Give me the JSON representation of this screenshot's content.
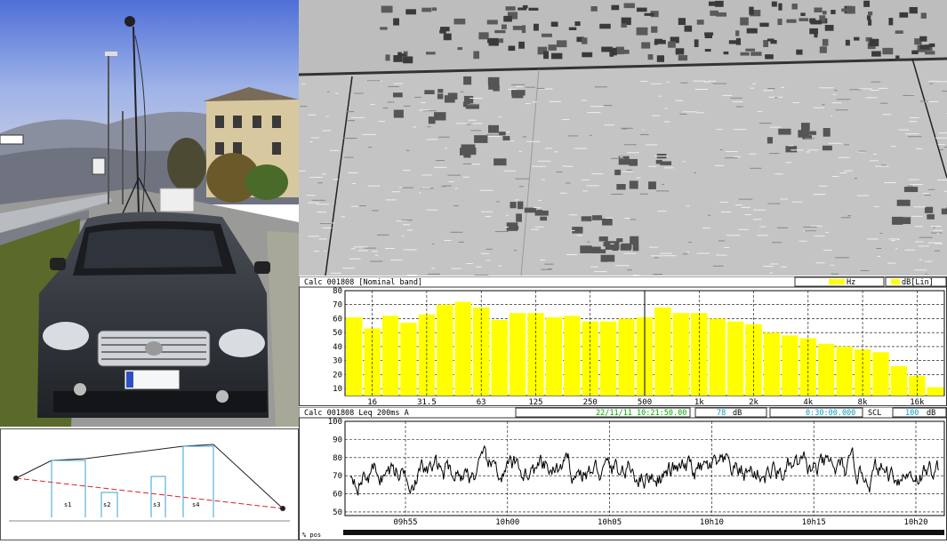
{
  "spectrum": {
    "header": {
      "left": "Calc 001808 [Nominal band]",
      "unit_hz": "Hz",
      "unit_db": "dB[Lin]",
      "swatch_color": "#ffff00"
    },
    "chart_data": {
      "type": "bar",
      "y_ticks": [
        "80",
        "70",
        "60",
        "50",
        "40",
        "30",
        "20",
        "10"
      ],
      "ylim": [
        5,
        80
      ],
      "x_tick_labels": [
        "16",
        "31.5",
        "63",
        "125",
        "250",
        "500",
        "1k",
        "2k",
        "4k",
        "8k",
        "16k"
      ],
      "bar_color": "#ffff00",
      "cursor_band_index": 17,
      "values": [
        61,
        53,
        62,
        57,
        63,
        70,
        72,
        68,
        59,
        64,
        64,
        61,
        62,
        58,
        58,
        60,
        61,
        68,
        64,
        64,
        60,
        58,
        56,
        50,
        48,
        46,
        42,
        40,
        38,
        36,
        26,
        19,
        11
      ]
    }
  },
  "timehist": {
    "header": {
      "left": "Calc 001808  Leq 200ms  A",
      "datetime": "22/11/11 10:21:50.00",
      "value": "78",
      "unit": "dB",
      "duration": "0:30:00.000",
      "scl_label": "SCL",
      "scl_value": "100",
      "scl_unit": "dB",
      "time_color": "#00aa00",
      "cyan_color": "#00a0c0"
    },
    "chart_data": {
      "type": "line",
      "y_ticks": [
        "100",
        "90",
        "80",
        "70",
        "60",
        "50"
      ],
      "ylim": [
        48,
        100
      ],
      "x_tick_labels": [
        "09h55",
        "10h00",
        "10h05",
        "10h10",
        "10h15",
        "10h20"
      ],
      "typical_level": 72,
      "range": [
        57,
        88
      ]
    },
    "footer_label": "% pos"
  },
  "diagram": {
    "labels": [
      "s1",
      "s2",
      "s3",
      "s4"
    ]
  }
}
